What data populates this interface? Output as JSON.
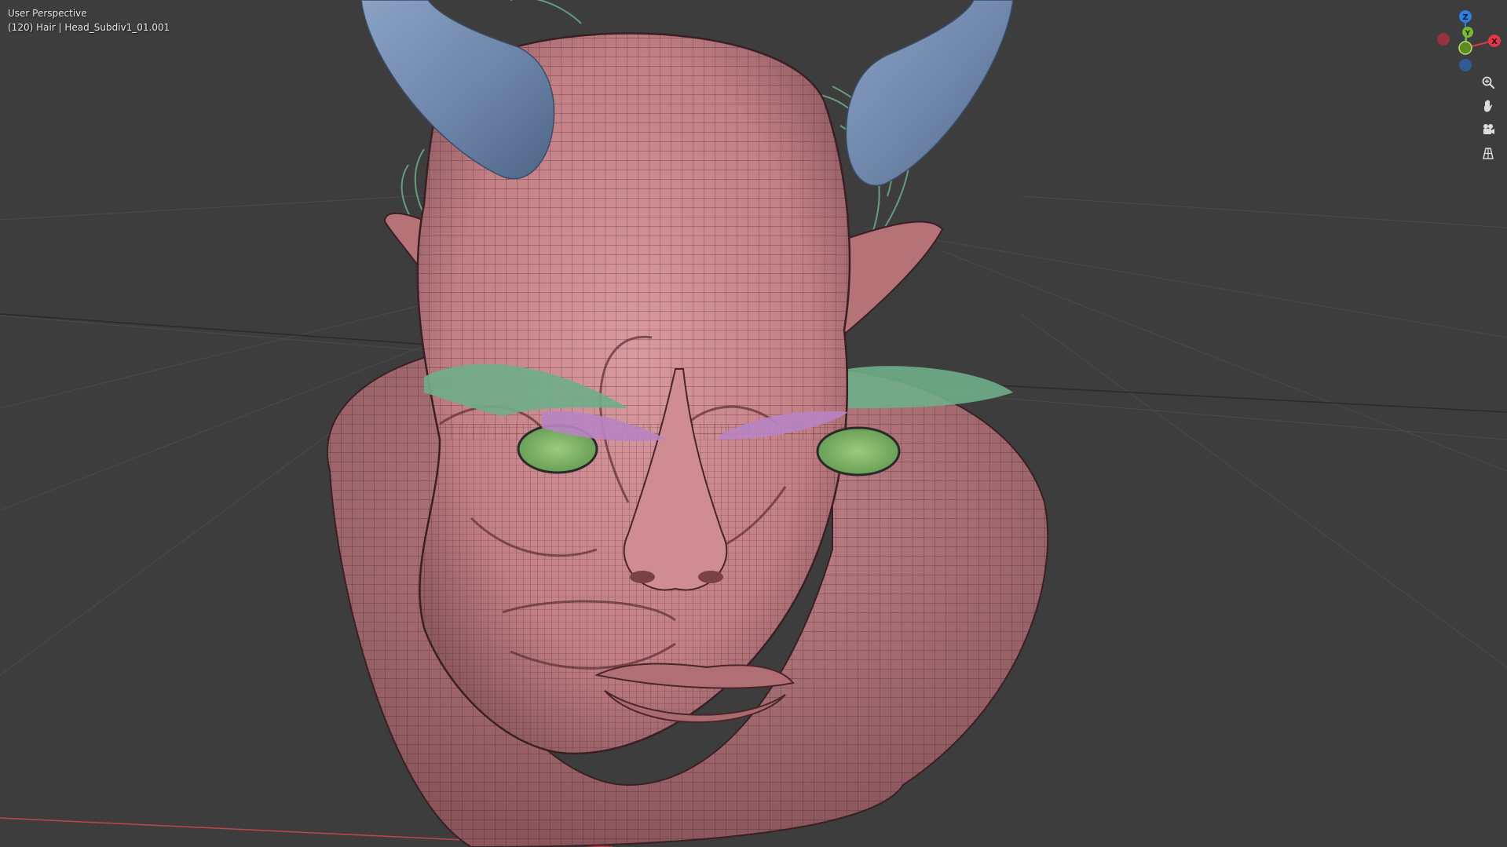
{
  "viewport": {
    "view_name": "User Perspective",
    "object_info": "(120) Hair | Head_Subdiv1_01.001"
  },
  "gizmo": {
    "axes": [
      {
        "axis": "Z",
        "label": "Z",
        "color": "#2f7fe0"
      },
      {
        "axis": "Y",
        "label": "Y",
        "color": "#7cb82e"
      },
      {
        "axis": "X",
        "label": "X",
        "color": "#e0384b"
      },
      {
        "axis": "-X",
        "label": "",
        "color": "#a0323e"
      },
      {
        "axis": "-Y",
        "label": "",
        "color": "#5c8a20"
      },
      {
        "axis": "-Z",
        "label": "",
        "color": "#2f5e9c"
      }
    ]
  },
  "nav_buttons": [
    {
      "name": "zoom-icon",
      "tooltip": "Zoom"
    },
    {
      "name": "pan-hand-icon",
      "tooltip": "Move"
    },
    {
      "name": "camera-icon",
      "tooltip": "Toggle camera view"
    },
    {
      "name": "grid-ortho-icon",
      "tooltip": "Toggle perspective/orthographic"
    }
  ],
  "colors": {
    "background": "#3d3d3d",
    "skin": "#c9878c",
    "horn": "#6f86a8",
    "hair": "#6fae88",
    "eyebrow": "#b884c4",
    "eye": "#7fb56a",
    "x_axis_line": "#c0454e"
  }
}
